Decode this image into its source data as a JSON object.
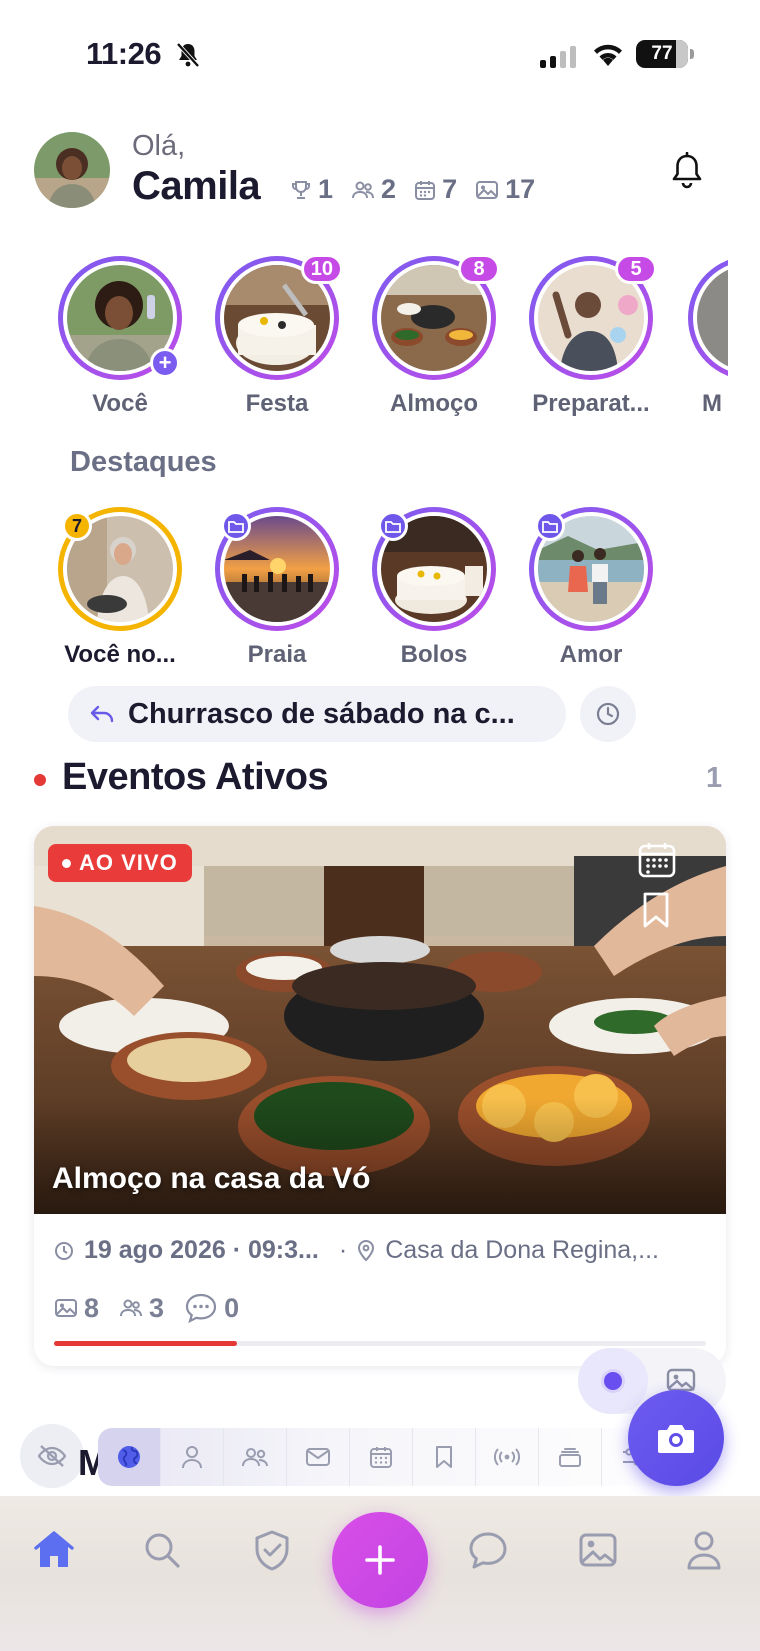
{
  "status_bar": {
    "time": "11:26",
    "battery": "77"
  },
  "header": {
    "greeting": "Olá,",
    "name": "Camila",
    "stats": {
      "trophies": "1",
      "groups": "2",
      "events": "7",
      "photos": "17"
    }
  },
  "stories": [
    {
      "label": "Você",
      "badge": "+"
    },
    {
      "label": "Festa",
      "badge": "10"
    },
    {
      "label": "Almoço",
      "badge": "8"
    },
    {
      "label": "Preparat...",
      "badge": "5"
    },
    {
      "label": "M"
    }
  ],
  "highlights": {
    "title": "Destaques",
    "items": [
      {
        "label": "Você no...",
        "badge": "7"
      },
      {
        "label": "Praia"
      },
      {
        "label": "Bolos"
      },
      {
        "label": "Amor"
      }
    ]
  },
  "reply": {
    "text": "Churrasco de sábado na c..."
  },
  "active_events": {
    "title": "Eventos Ativos",
    "count": "1",
    "card": {
      "live_label": "AO VIVO",
      "title": "Almoço na casa da Vó",
      "datetime": "19 ago 2026 · 09:3...",
      "separator": "·",
      "location": "Casa da Dona Regina,...",
      "photos": "8",
      "people": "3",
      "comments": "0",
      "progress": 0.28
    }
  },
  "peek_heading": "M",
  "colors": {
    "accent": "#6d5cf0",
    "fab": "#d94ee8",
    "live": "#ea3b3b",
    "gold": "#f4b400"
  }
}
